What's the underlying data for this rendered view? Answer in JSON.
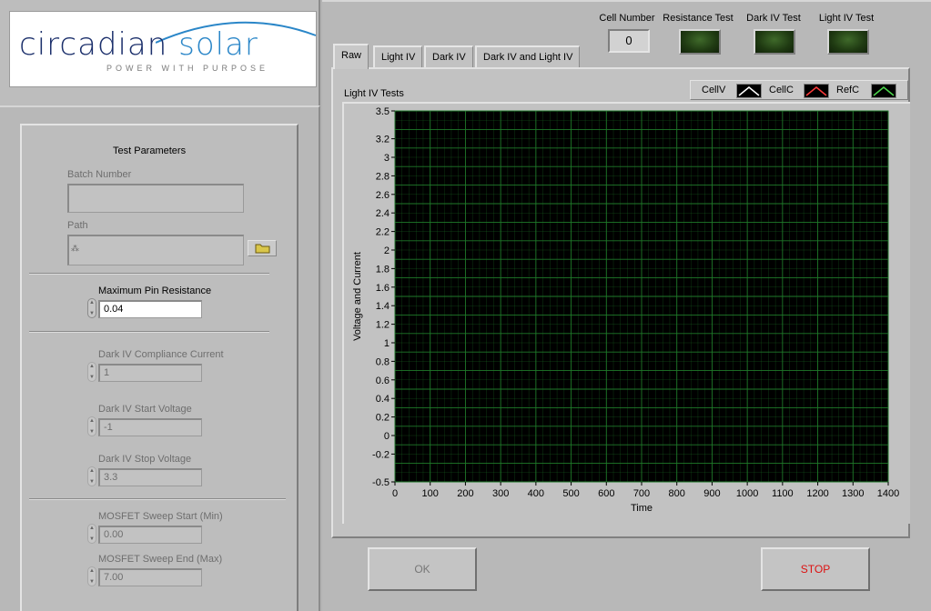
{
  "logo": {
    "word1": "circadian",
    "word2": "solar",
    "tagline": "POWER WITH PURPOSE"
  },
  "params": {
    "title": "Test Parameters",
    "batch_label": "Batch Number",
    "batch_value": "",
    "path_label": "Path",
    "path_value": "",
    "max_pin_label": "Maximum Pin Resistance",
    "max_pin_value": "0.04",
    "dark_compliance_label": "Dark IV Compliance Current",
    "dark_compliance_value": "1",
    "dark_start_label": "Dark IV Start Voltage",
    "dark_start_value": "-1",
    "dark_stop_label": "Dark IV Stop Voltage",
    "dark_stop_value": "3.3",
    "mosfet_start_label": "MOSFET Sweep Start (Min)",
    "mosfet_start_value": "0.00",
    "mosfet_end_label": "MOSFET Sweep End (Max)",
    "mosfet_end_value": "7.00"
  },
  "indicators": {
    "cell_number_label": "Cell Number",
    "cell_number_value": "0",
    "resistance_label": "Resistance Test",
    "dark_iv_label": "Dark IV Test",
    "light_iv_label": "Light IV Test",
    "led_color": "#1f3a12"
  },
  "tabs": [
    {
      "label": "Raw"
    },
    {
      "label": "Light IV"
    },
    {
      "label": "Dark IV"
    },
    {
      "label": "Dark IV and Light IV"
    }
  ],
  "graph": {
    "title": "Light IV Tests",
    "legend": [
      {
        "name": "CellV",
        "color": "#ffffff"
      },
      {
        "name": "CellC",
        "color": "#ff3b3b"
      },
      {
        "name": "RefC",
        "color": "#4cd64c"
      }
    ]
  },
  "chart_data": {
    "type": "line",
    "title": "Light IV Tests",
    "xlabel": "Time",
    "ylabel": "Voltage and Current",
    "xlim": [
      0,
      1400
    ],
    "ylim": [
      -0.5,
      3.5
    ],
    "x_ticks": [
      "0",
      "100",
      "200",
      "300",
      "400",
      "500",
      "600",
      "700",
      "800",
      "900",
      "1000",
      "1100",
      "1200",
      "1300",
      "1400"
    ],
    "y_ticks": [
      "3.5",
      "3.2",
      "3",
      "2.8",
      "2.6",
      "2.4",
      "2.2",
      "2",
      "1.8",
      "1.6",
      "1.4",
      "1.2",
      "1",
      "0.8",
      "0.6",
      "0.4",
      "0.2",
      "0",
      "-0.2",
      "-0.5"
    ],
    "grid": true,
    "plot_background": "#000000",
    "grid_color": "#1f7a2a",
    "series": [
      {
        "name": "CellV",
        "values": []
      },
      {
        "name": "CellC",
        "values": []
      },
      {
        "name": "RefC",
        "values": []
      }
    ]
  },
  "buttons": {
    "ok": "OK",
    "stop": "STOP"
  }
}
